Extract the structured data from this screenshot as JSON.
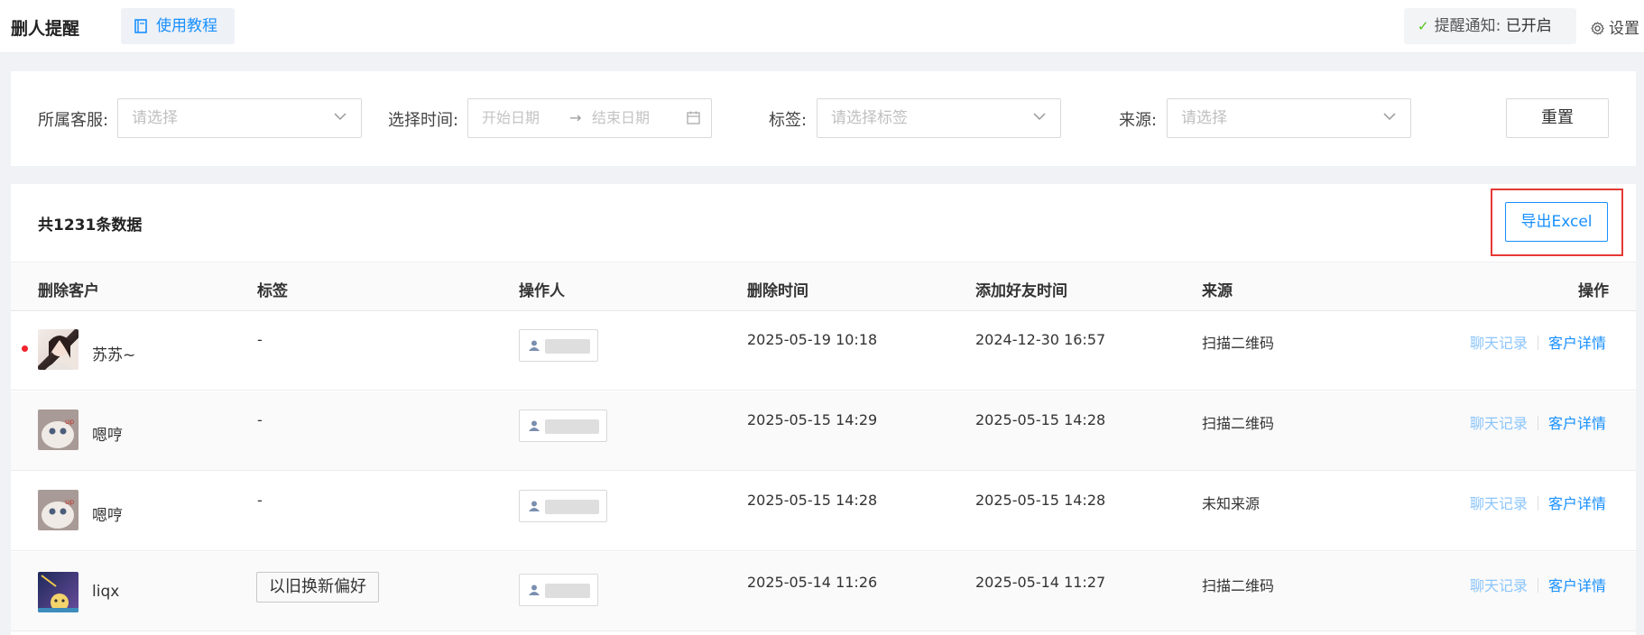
{
  "header": {
    "title": "删人提醒",
    "tutorial_label": "使用教程",
    "notify_label": "提醒通知:",
    "notify_status": "已开启",
    "settings_label": "设置"
  },
  "filters": {
    "service_label": "所属客服:",
    "service_placeholder": "请选择",
    "time_label": "选择时间:",
    "start_placeholder": "开始日期",
    "range_separator": "→",
    "end_placeholder": "结束日期",
    "tag_label": "标签:",
    "tag_placeholder": "请选择标签",
    "source_label": "来源:",
    "source_placeholder": "请选择",
    "reset_label": "重置"
  },
  "table": {
    "total_text": "共1231条数据",
    "export_label": "导出Excel",
    "columns": [
      "删除客户",
      "标签",
      "操作人",
      "删除时间",
      "添加好友时间",
      "来源",
      "操作"
    ],
    "action_chat": "聊天记录",
    "action_detail": "客户详情",
    "rows": [
      {
        "name": "苏苏~",
        "tag": "-",
        "delete_time": "2025-05-19 10:18",
        "add_time": "2024-12-30 16:57",
        "source": "扫描二维码",
        "unread": true
      },
      {
        "name": "嗯哼",
        "tag": "-",
        "delete_time": "2025-05-15 14:29",
        "add_time": "2025-05-15 14:28",
        "source": "扫描二维码",
        "unread": false
      },
      {
        "name": "嗯哼",
        "tag": "-",
        "delete_time": "2025-05-15 14:28",
        "add_time": "2025-05-15 14:28",
        "source": "未知来源",
        "unread": false
      },
      {
        "name": "liqx",
        "tag": "以旧换新偏好",
        "delete_time": "2025-05-14 11:26",
        "add_time": "2025-05-14 11:27",
        "source": "扫描二维码",
        "unread": false
      }
    ]
  },
  "colors": {
    "primary": "#1890ff",
    "success": "#52c41a",
    "highlight_border": "#e53935",
    "unread_dot": "#f5222d"
  }
}
